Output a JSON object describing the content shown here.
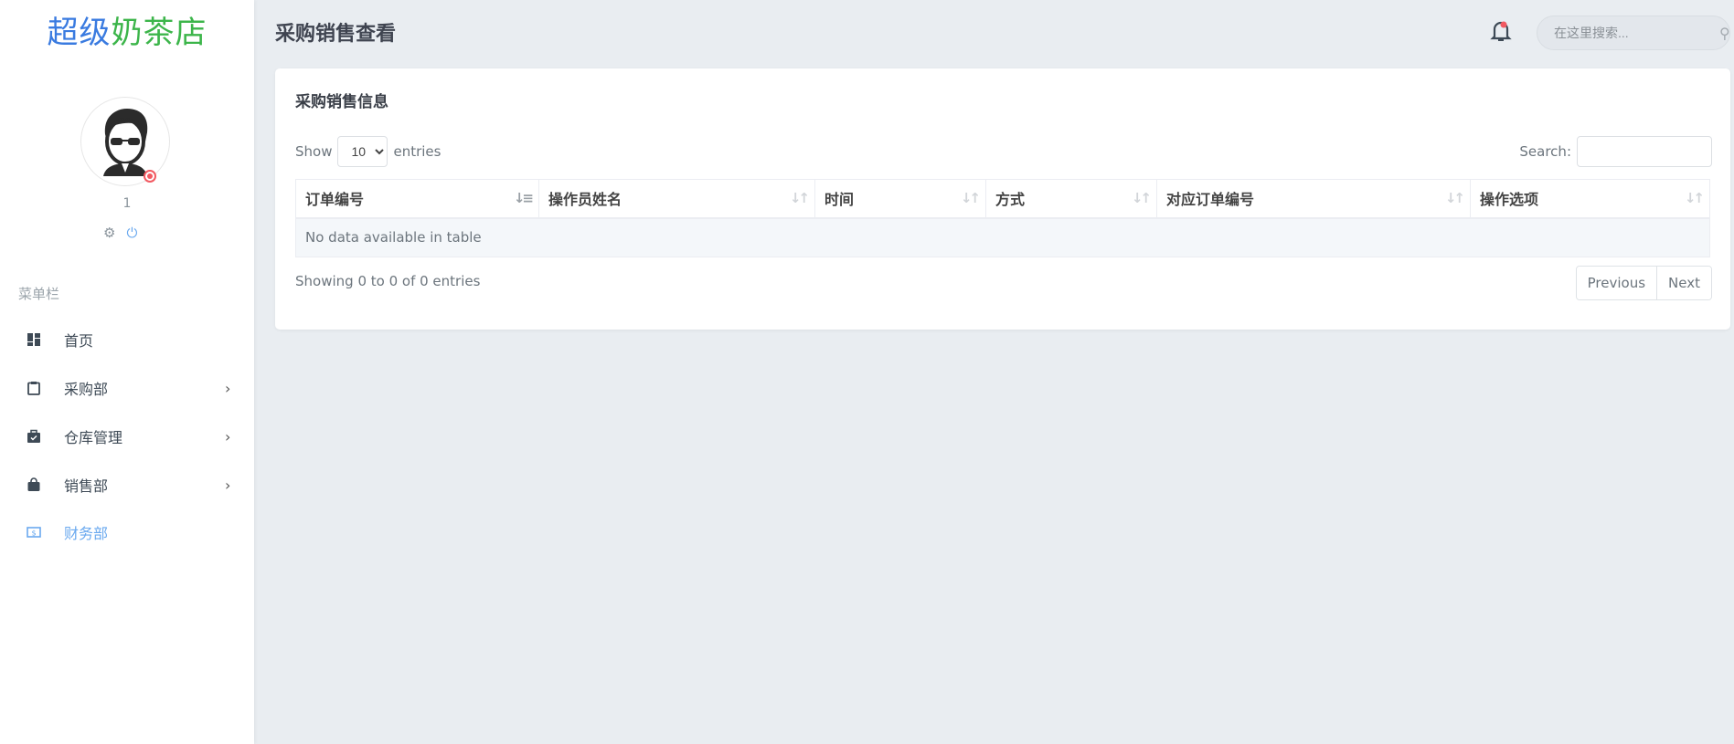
{
  "sidebar": {
    "logo": {
      "part1": "超级",
      "part2": "奶茶店"
    },
    "user": {
      "name": "1",
      "status": "online"
    },
    "menu_title": "菜单栏",
    "items": [
      {
        "label": "首页",
        "icon": "dashboard-icon",
        "has_children": false,
        "active": false
      },
      {
        "label": "采购部",
        "icon": "clipboard-icon",
        "has_children": true,
        "active": false
      },
      {
        "label": "仓库管理",
        "icon": "briefcase-check-icon",
        "has_children": true,
        "active": false
      },
      {
        "label": "销售部",
        "icon": "shopping-bag-icon",
        "has_children": true,
        "active": false
      },
      {
        "label": "财务部",
        "icon": "money-icon",
        "has_children": false,
        "active": true
      }
    ]
  },
  "header": {
    "title": "采购销售查看",
    "search_placeholder": "在这里搜索..."
  },
  "card": {
    "title": "采购销售信息",
    "length": {
      "show": "Show",
      "value": "10",
      "entries": "entries"
    },
    "filter_label": "Search:",
    "columns": [
      "订单编号",
      "操作员姓名",
      "时间",
      "方式",
      "对应订单编号",
      "操作选项"
    ],
    "empty": "No data available in table",
    "info": "Showing 0 to 0 of 0 entries",
    "prev": "Previous",
    "next": "Next"
  },
  "colors": {
    "accent": "#6aa9ef",
    "status": "#f25961"
  }
}
